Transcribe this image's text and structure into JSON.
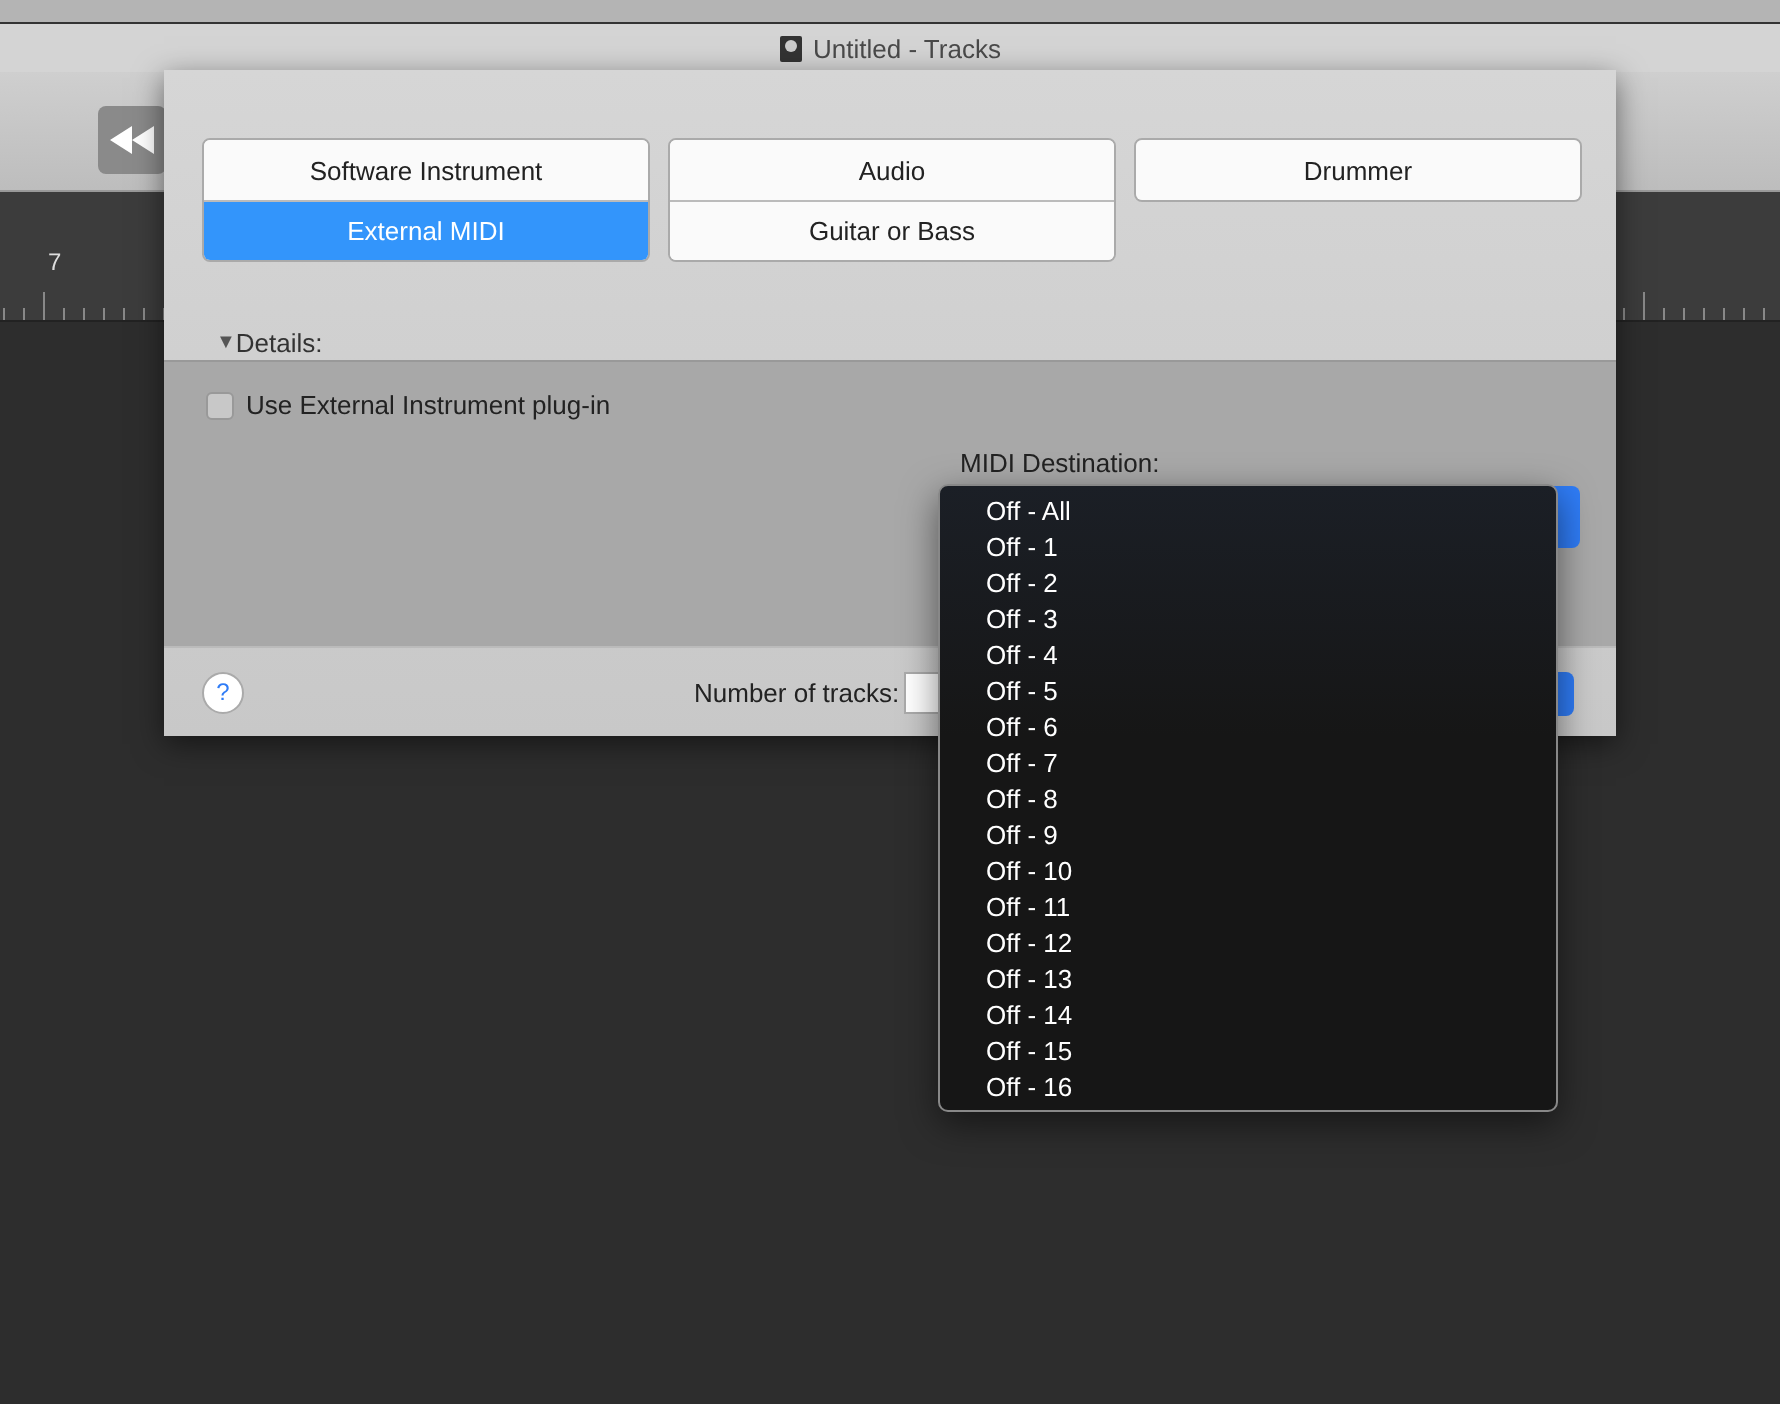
{
  "window": {
    "title": "Untitled - Tracks"
  },
  "ruler": {
    "bar": "7"
  },
  "track_types": [
    {
      "items": [
        {
          "label": "Software Instrument",
          "selected": false
        },
        {
          "label": "External MIDI",
          "selected": true
        }
      ]
    },
    {
      "items": [
        {
          "label": "Audio",
          "selected": false
        },
        {
          "label": "Guitar or Bass",
          "selected": false
        }
      ]
    },
    {
      "items": [
        {
          "label": "Drummer",
          "selected": false
        }
      ]
    }
  ],
  "details": {
    "toggle": "▼",
    "label": "Details:",
    "expanded": true,
    "use_external_plugin": {
      "label": "Use External Instrument plug-in",
      "checked": false
    },
    "midi_destination": {
      "label": "MIDI Destination:"
    }
  },
  "footer": {
    "help": "?",
    "tracks_label": "Number of tracks:"
  },
  "menu": {
    "items": [
      "Off - All",
      "Off - 1",
      "Off - 2",
      "Off - 3",
      "Off - 4",
      "Off - 5",
      "Off - 6",
      "Off - 7",
      "Off - 8",
      "Off - 9",
      "Off - 10",
      "Off - 11",
      "Off - 12",
      "Off - 13",
      "Off - 14",
      "Off - 15",
      "Off - 16"
    ]
  }
}
